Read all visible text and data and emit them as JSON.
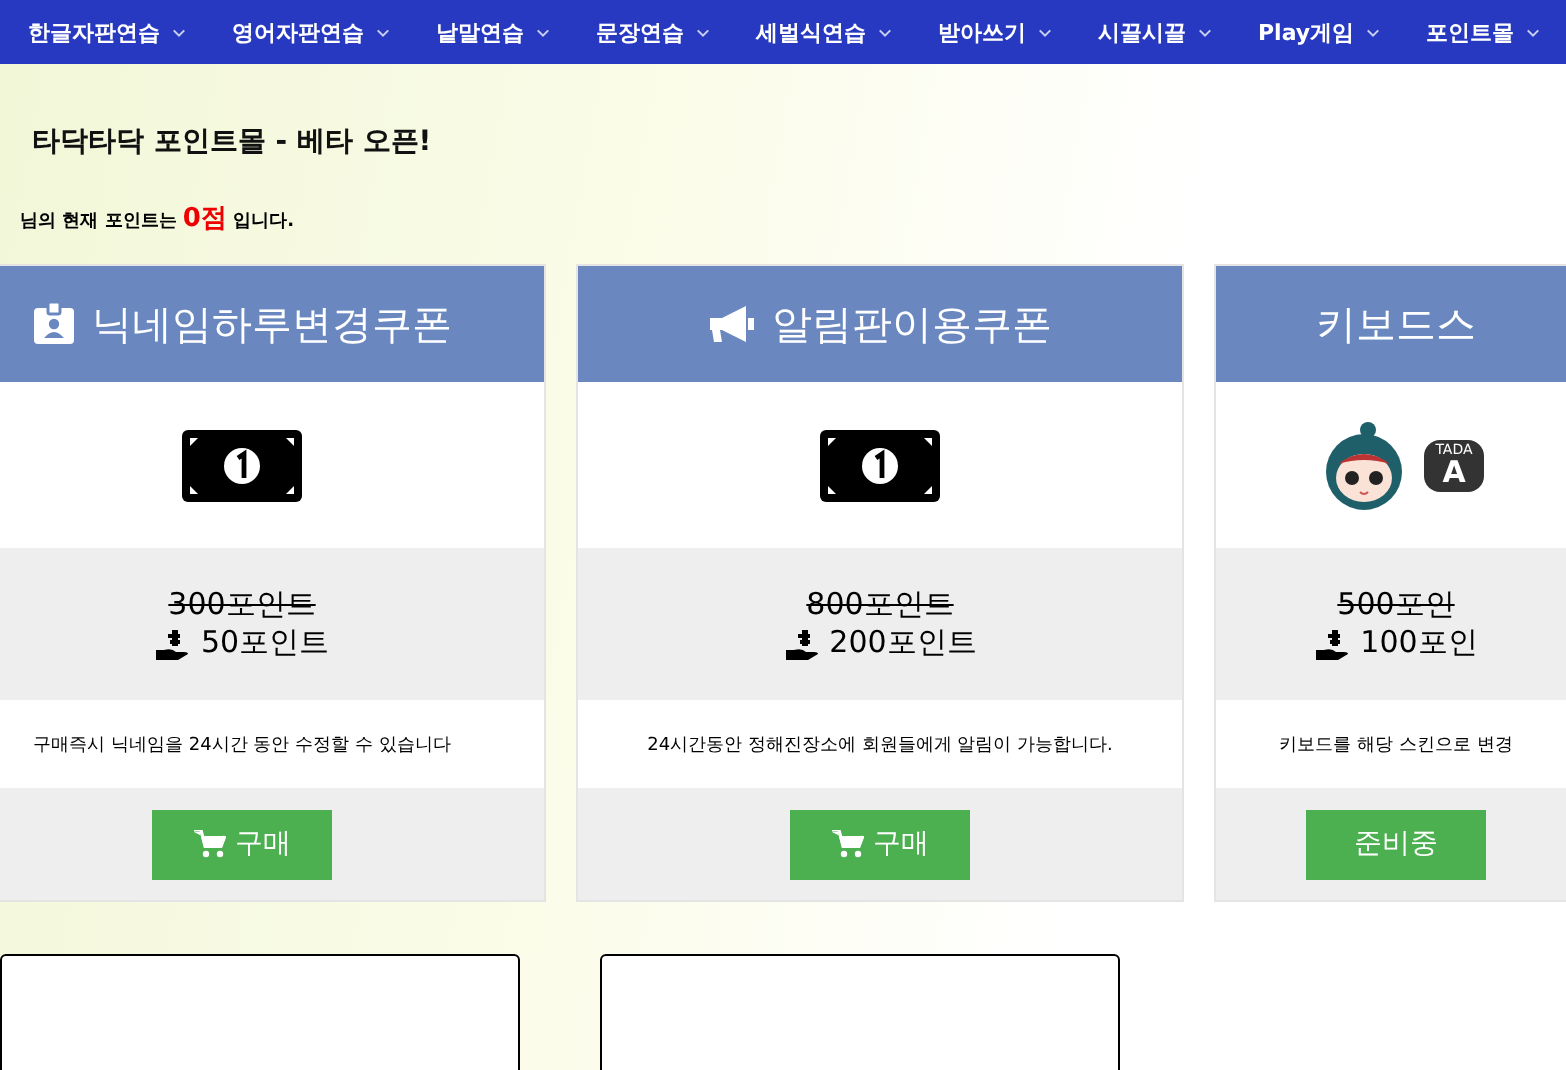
{
  "nav": {
    "items": [
      {
        "label": "한글자판연습"
      },
      {
        "label": "영어자판연습"
      },
      {
        "label": "낱말연습"
      },
      {
        "label": "문장연습"
      },
      {
        "label": "세벌식연습"
      },
      {
        "label": "받아쓰기"
      },
      {
        "label": "시끌시끌"
      },
      {
        "label": "Play게임"
      },
      {
        "label": "포인트몰"
      }
    ]
  },
  "header": {
    "title": "타닥타닥 포인트몰 - 베타 오픈!",
    "points_line": "님의 현재 포인트는 **0점** 입니다."
  },
  "cards": [
    {
      "kind": "nickname",
      "title": "닉네임하루변경쿠폰",
      "old_price": "300포인트",
      "price": "50포인트",
      "description": "구매즉시 닉네임을 24시간 동안 수정할 수 있습니다",
      "button": {
        "label": "구매"
      }
    },
    {
      "kind": "notice",
      "title": "알림판이용쿠폰",
      "old_price": "800포인트",
      "price": "200포인트",
      "description": "24시간동안 정해진장소에 회원들에게 알림이 가능합니다.",
      "button": {
        "label": "구매"
      }
    },
    {
      "kind": "skin",
      "title": "키보드스",
      "bubble_text": [
        "TADA",
        "A"
      ],
      "old_price": "500포인",
      "price": "100포인",
      "description": "키보드를 해당 스킨으로 변경",
      "button": {
        "label": "준비중"
      }
    }
  ],
  "bottom_panels": [
    {
      "kind": "empty"
    },
    {
      "kind": "empty"
    }
  ]
}
